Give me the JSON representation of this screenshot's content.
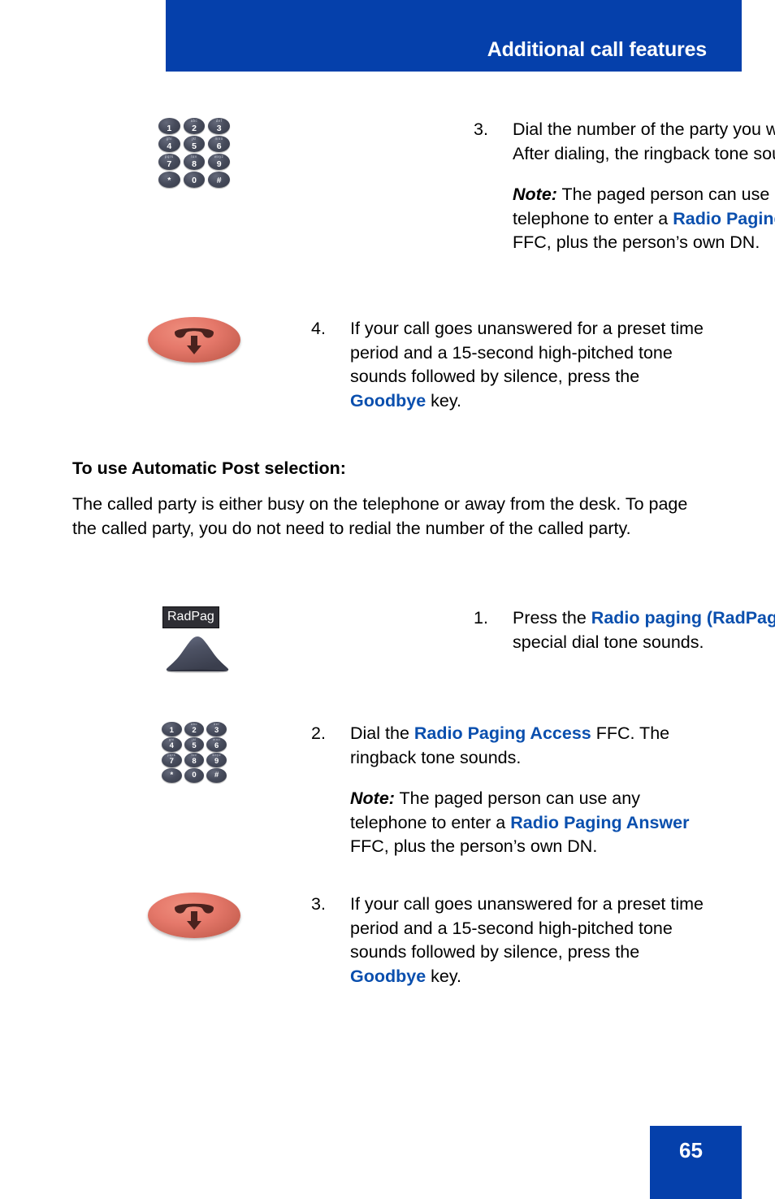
{
  "header": {
    "title": "Additional call features"
  },
  "footer": {
    "page_number": "65",
    "accent_color": "#0540ab"
  },
  "colors": {
    "header_blue": "#0540ab",
    "link_blue": "#0a4fae",
    "key_dark": "#474c5c",
    "goodbye_red": "#e5786a",
    "label_dark": "#2e2e34"
  },
  "keypad": {
    "keys": [
      {
        "digit": "1",
        "letters": ""
      },
      {
        "digit": "2",
        "letters": "abc"
      },
      {
        "digit": "3",
        "letters": "def"
      },
      {
        "digit": "4",
        "letters": "ghi"
      },
      {
        "digit": "5",
        "letters": "jkl"
      },
      {
        "digit": "6",
        "letters": "mno"
      },
      {
        "digit": "7",
        "letters": "pqrs"
      },
      {
        "digit": "8",
        "letters": "tuv"
      },
      {
        "digit": "9",
        "letters": "wxyz"
      },
      {
        "digit": "*",
        "letters": ""
      },
      {
        "digit": "0",
        "letters": ""
      },
      {
        "digit": "#",
        "letters": ""
      }
    ]
  },
  "icons": {
    "radpag_label": "RadPag"
  },
  "steps_top": [
    {
      "number": "3.",
      "icon": "dialpad-icon",
      "text_html": "Dial the number of the party you want to page. After dialing, the ringback tone sounds.",
      "note_label": "Note:",
      "note_html": "The paged person can use any telephone to enter a <b>Radio Paging Answer</b> FFC, plus the person’s own DN."
    },
    {
      "number": "4.",
      "icon": "goodbye-key-icon",
      "text_html": "If your call goes unanswered for a preset time period and a 15-second high-pitched tone sounds followed by silence, press the <b>Goodbye</b> key."
    }
  ],
  "section": {
    "heading": "To use Automatic Post selection:",
    "paragraph": "The called party is either busy on the telephone or away from the desk. To page the called party, you do not need to redial the number of the called party."
  },
  "steps_bottom": [
    {
      "number": "1.",
      "icon": "radpag-key-icon",
      "text_html": "Press the <b>Radio paging (RadPag)</b> key. A special dial tone sounds."
    },
    {
      "number": "2.",
      "icon": "dialpad-icon",
      "text_html": "Dial the <b>Radio Paging Access</b> FFC. The ringback tone sounds.",
      "note_label": "Note:",
      "note_html": "The paged person can use any telephone to enter a <b>Radio Paging Answer</b> FFC, plus the person’s own DN."
    },
    {
      "number": "3.",
      "icon": "goodbye-key-icon",
      "text_html": "If your call goes unanswered for a preset time period and a 15-second high-pitched tone sounds followed by silence, press the <b>Goodbye</b> key."
    }
  ]
}
